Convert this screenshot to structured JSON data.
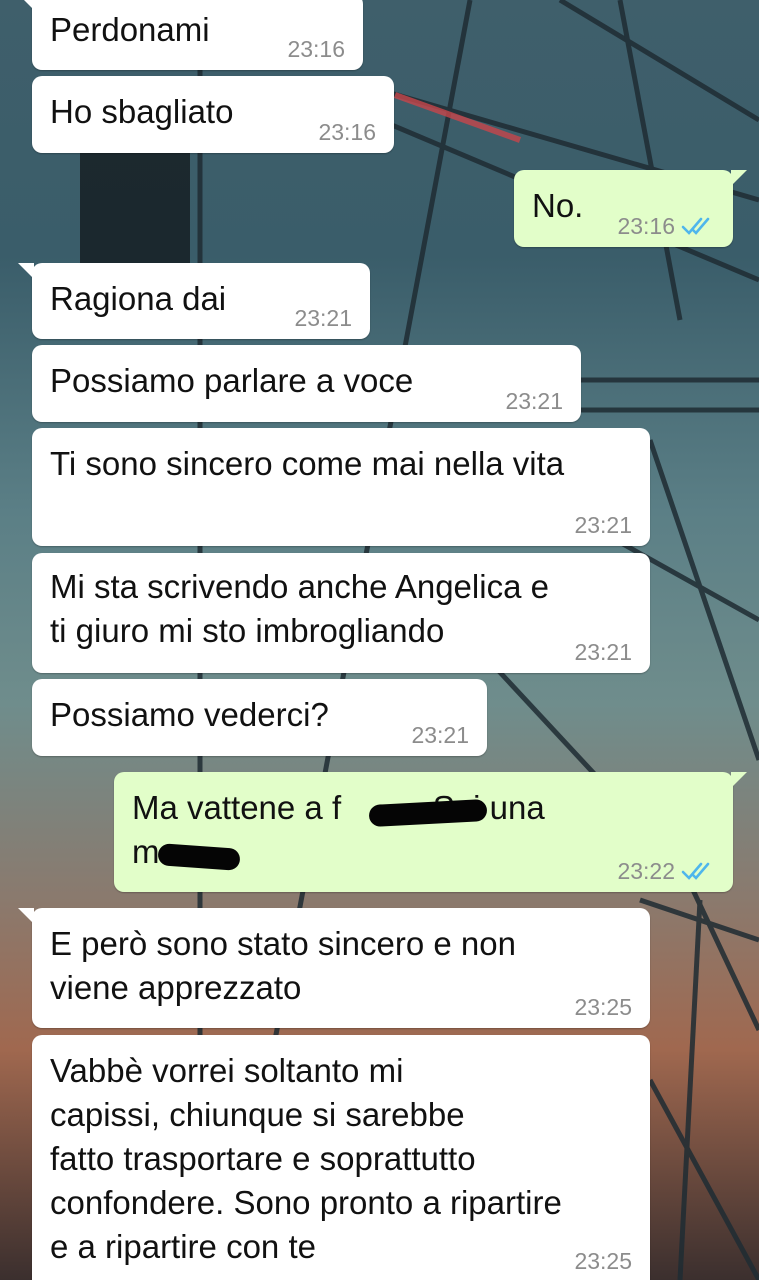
{
  "messages": [
    {
      "side": "in",
      "text": "Perdonami",
      "time": "23:16"
    },
    {
      "side": "in",
      "text": "Ho sbagliato",
      "time": "23:16"
    },
    {
      "side": "out",
      "text": "No.",
      "time": "23:16",
      "status": "read"
    },
    {
      "side": "in",
      "text": "Ragiona dai",
      "time": "23:21"
    },
    {
      "side": "in",
      "text": "Possiamo parlare a voce",
      "time": "23:21"
    },
    {
      "side": "in",
      "text": "Ti sono sincero come mai nella vita",
      "time": "23:21"
    },
    {
      "side": "in",
      "text": "Mi sta scrivendo anche Angelica e\nti giuro mi sto imbrogliando",
      "time": "23:21"
    },
    {
      "side": "in",
      "text": "Possiamo vederci?",
      "time": "23:21"
    },
    {
      "side": "out",
      "text": "Ma vattene a f        . Sei una\nm",
      "time": "23:22",
      "status": "read"
    },
    {
      "side": "in",
      "text": "E però sono stato sincero e non\nviene apprezzato",
      "time": "23:25"
    },
    {
      "side": "in",
      "text": "Vabbè vorrei soltanto mi\ncapissi, chiunque si sarebbe\nfatto trasportare e soprattutto\nconfondere. Sono pronto a ripartire\ne a ripartire con te",
      "time": "23:25"
    }
  ],
  "colors": {
    "incoming_bubble": "#ffffff",
    "outgoing_bubble": "#e2fec9",
    "read_ticks": "#4fb6ec",
    "timestamp": "#8c8c8c"
  },
  "icons": {
    "read_receipt": "double-check-icon"
  }
}
